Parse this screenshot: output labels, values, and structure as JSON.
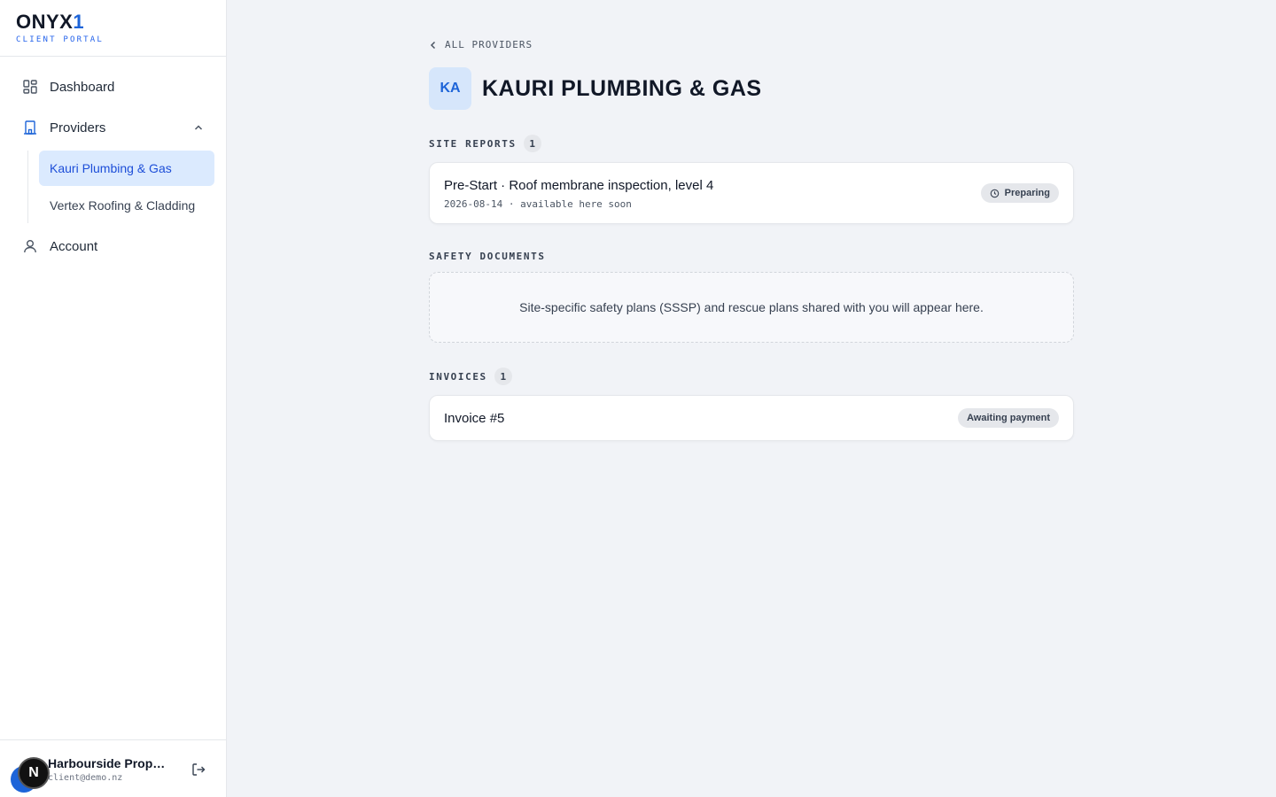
{
  "brand": {
    "name_main": "ONYX",
    "name_accent": "1",
    "subtitle": "CLIENT PORTAL"
  },
  "sidebar": {
    "items": [
      {
        "label": "Dashboard",
        "icon": "dashboard-icon"
      },
      {
        "label": "Providers",
        "icon": "building-icon",
        "expanded": true,
        "children": [
          {
            "label": "Kauri Plumbing & Gas",
            "active": true
          },
          {
            "label": "Vertex Roofing & Cladding",
            "active": false
          }
        ]
      },
      {
        "label": "Account",
        "icon": "user-icon"
      }
    ]
  },
  "user": {
    "avatar_initial": "N",
    "name": "Harbourside Properties",
    "email": "client@demo.nz"
  },
  "main": {
    "back_label": "ALL PROVIDERS",
    "provider_initials": "KA",
    "title": "KAURI PLUMBING & GAS",
    "site_reports": {
      "label": "SITE REPORTS",
      "count": "1",
      "items": [
        {
          "title": "Pre-Start · Roof membrane inspection, level 4",
          "meta": "2026-08-14 · available here soon",
          "status": "Preparing"
        }
      ]
    },
    "safety_documents": {
      "label": "SAFETY DOCUMENTS",
      "empty_text": "Site-specific safety plans (SSSP) and rescue plans shared with you will appear here."
    },
    "invoices": {
      "label": "INVOICES",
      "count": "1",
      "items": [
        {
          "title": "Invoice #5",
          "status": "Awaiting payment"
        }
      ]
    }
  },
  "colors": {
    "accent": "#1d64d8",
    "active_bg": "#dbeafe",
    "page_bg": "#f1f3f7"
  }
}
